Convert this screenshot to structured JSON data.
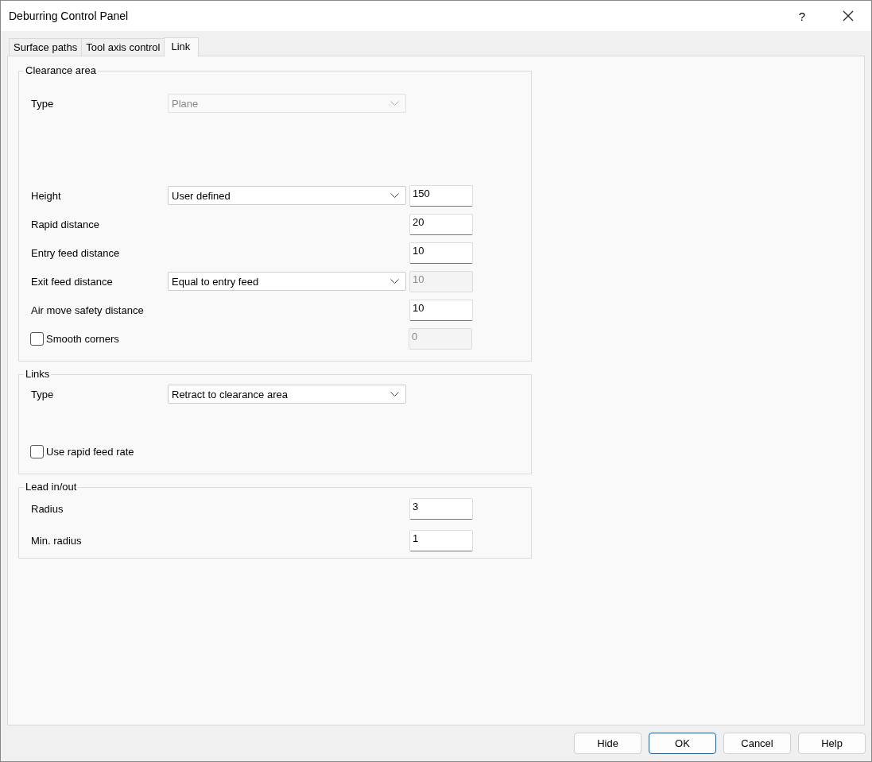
{
  "window": {
    "title": "Deburring Control Panel",
    "help": "?"
  },
  "tabs": [
    {
      "label": "Surface paths",
      "selected": false
    },
    {
      "label": "Tool axis control",
      "selected": false
    },
    {
      "label": "Link",
      "selected": true
    }
  ],
  "groups": [
    {
      "title": "Clearance area",
      "rows": [
        {
          "kind": "select",
          "label": "Type",
          "select": {
            "value": "Plane",
            "disabled": true
          }
        },
        {
          "kind": "select_field",
          "label": "Height",
          "select": {
            "value": "User defined",
            "disabled": false
          },
          "field": {
            "value": "150",
            "disabled": false
          }
        },
        {
          "kind": "field",
          "label": "Rapid distance",
          "field": {
            "value": "20",
            "disabled": false
          }
        },
        {
          "kind": "field",
          "label": "Entry feed distance",
          "field": {
            "value": "10",
            "disabled": false
          }
        },
        {
          "kind": "select_field",
          "label": "Exit feed distance",
          "select": {
            "value": "Equal to entry feed",
            "disabled": false
          },
          "field": {
            "value": "10",
            "disabled": true
          }
        },
        {
          "kind": "field",
          "label": "Air move safety distance",
          "field": {
            "value": "10",
            "disabled": false
          }
        },
        {
          "kind": "check_field",
          "label": "Smooth corners",
          "checked": false,
          "field": {
            "value": "0",
            "disabled": true
          }
        }
      ]
    },
    {
      "title": "Links",
      "rows": [
        {
          "kind": "select",
          "label": "Type",
          "select": {
            "value": "Retract to clearance area",
            "disabled": false
          }
        },
        {
          "kind": "check",
          "label": "Use rapid feed rate",
          "checked": false
        }
      ]
    },
    {
      "title": "Lead in/out",
      "rows": [
        {
          "kind": "field",
          "label": "Radius",
          "field": {
            "value": "3",
            "disabled": false
          }
        },
        {
          "kind": "field",
          "label": "Min. radius",
          "field": {
            "value": "1",
            "disabled": false
          }
        }
      ]
    }
  ],
  "buttons": [
    {
      "label": "Hide",
      "default": false
    },
    {
      "label": "OK",
      "default": true
    },
    {
      "label": "Cancel",
      "default": false
    },
    {
      "label": "Help",
      "default": false
    }
  ]
}
